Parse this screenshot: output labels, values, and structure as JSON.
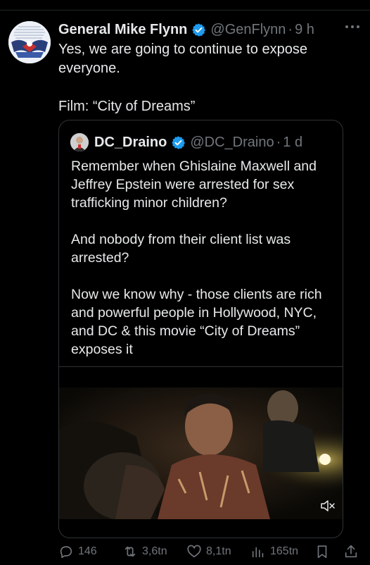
{
  "tweet": {
    "author_name": "General Mike Flynn",
    "handle": "@GenFlynn",
    "separator": "·",
    "time": "9 h",
    "text": "Yes, we are going to continue to expose\neveryone.\n\nFilm: “City of Dreams”"
  },
  "quote": {
    "author_name": "DC_Draino",
    "handle": "@DC_Draino",
    "separator": "·",
    "time": "1 d",
    "text": "Remember when Ghislaine Maxwell and\nJeffrey Epstein were arrested for sex\ntrafficking minor children?\n\nAnd nobody from their client list was\narrested?\n\nNow we know why - those clients are rich\nand powerful people in Hollywood, NYC,\nand DC & this movie “City of Dreams”\nexposes it"
  },
  "actions": {
    "replies": "146",
    "retweets": "3,6tn",
    "likes": "8,1tn",
    "views": "165tn"
  },
  "icons": [
    "verified-badge-icon",
    "more-icon",
    "mute-icon",
    "reply-icon",
    "retweet-icon",
    "like-icon",
    "views-icon",
    "bookmark-icon",
    "share-icon"
  ],
  "colors": {
    "background": "#000000",
    "text": "#e7e9ea",
    "secondary": "#71767b",
    "verified": "#1d9bf0",
    "border": "#2f3336"
  }
}
